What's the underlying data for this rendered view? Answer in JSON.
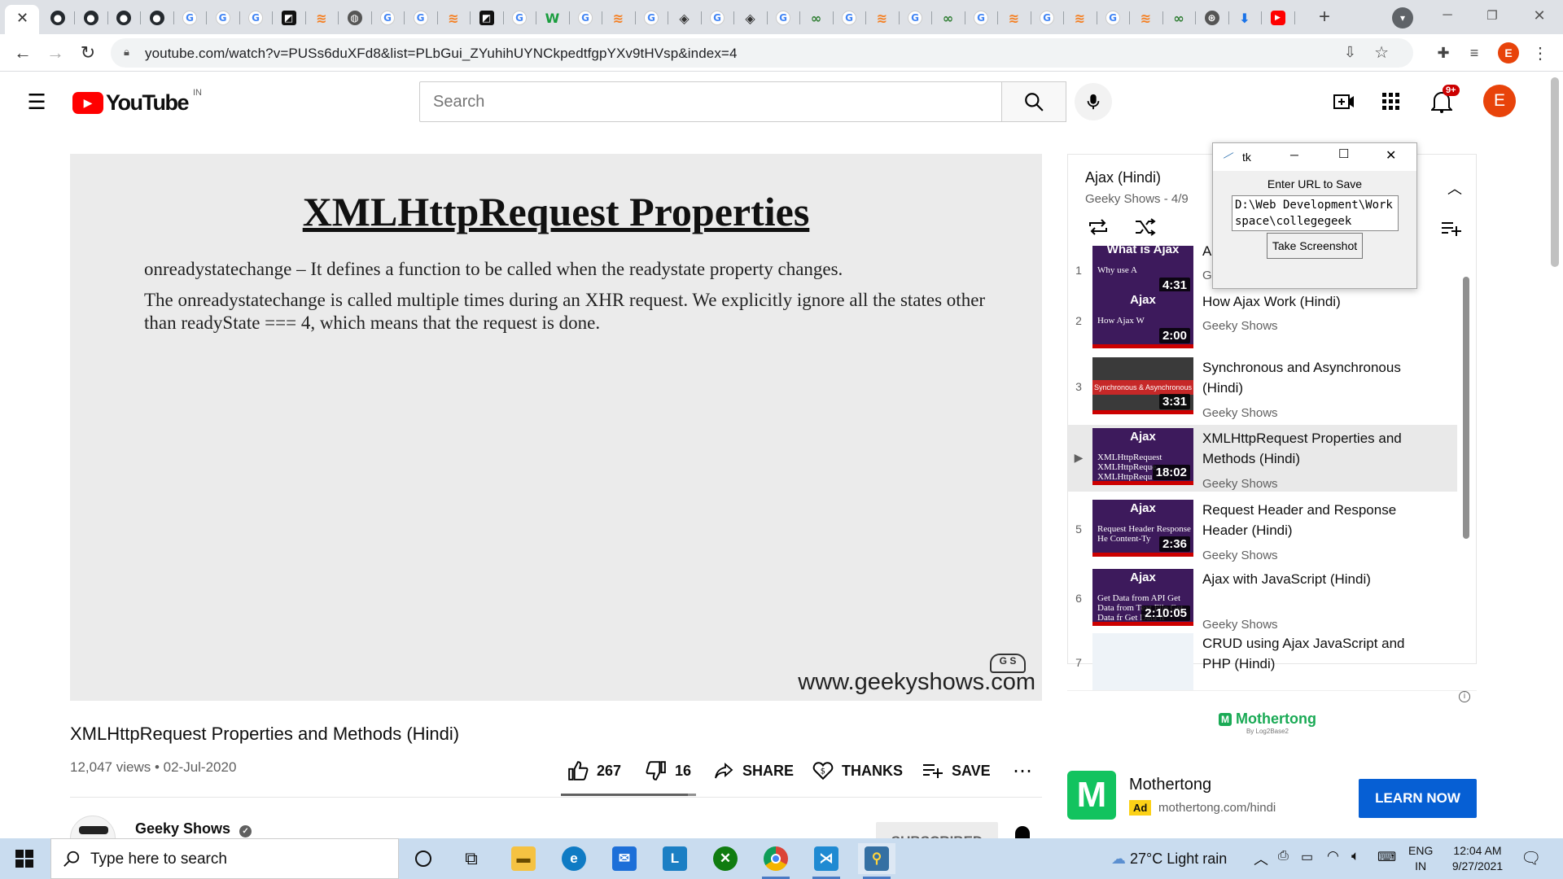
{
  "browser": {
    "url": "youtube.com/watch?v=PUSs6duXFd8&list=PLbGui_ZYuhihUYNCkpedtfgpYXv9tHVsp&index=4",
    "profile_initial": "E",
    "tabs": [
      "close-icon",
      "github",
      "github",
      "github",
      "github",
      "google",
      "google",
      "google",
      "square-app",
      "stack-overflow",
      "globe",
      "google",
      "google",
      "stack-overflow",
      "square-app",
      "google",
      "w-app",
      "google",
      "stack-overflow",
      "google",
      "diamond",
      "google",
      "diamond",
      "google",
      "infinity",
      "google",
      "stack-overflow",
      "google",
      "infinity",
      "google",
      "stack-overflow",
      "google",
      "stack-overflow",
      "google",
      "stack-overflow",
      "infinity",
      "wheel",
      "download",
      "youtube"
    ]
  },
  "youtube": {
    "logo_text": "YouTube",
    "region": "IN",
    "search_placeholder": "Search",
    "notification_count": "9+",
    "avatar_initial": "E"
  },
  "video": {
    "slide_title": "XMLHttpRequest Properties",
    "slide_p1": "onreadystatechange – It defines a function to be called when the readystate property changes.",
    "slide_p2": "The onreadystatechange is called multiple times during an XHR request. We explicitly ignore all the states other than readyState === 4, which means that the request is done.",
    "watermark": "www.geekyshows.com",
    "title": "XMLHttpRequest Properties and Methods (Hindi)",
    "views": "12,047 views • 02-Jul-2020",
    "likes": "267",
    "dislikes": "16",
    "like_ratio": 0.94,
    "share_label": "SHARE",
    "thanks_label": "THANKS",
    "save_label": "SAVE",
    "channel": "Geeky Shows",
    "subscribe_label": "SUBSCRIBED"
  },
  "playlist": {
    "title": "Ajax (Hindi)",
    "subtitle": "Geeky Shows - 4/9",
    "items": [
      {
        "index": "1",
        "thumb_text": "What is Ajax",
        "thumb_sub": "Why use A",
        "duration": "4:31",
        "title": "A",
        "channel": "Gi"
      },
      {
        "index": "2",
        "thumb_text": "Ajax",
        "thumb_sub": "How Ajax W",
        "duration": "2:00",
        "title": "How Ajax Work (Hindi)",
        "channel": "Geeky Shows"
      },
      {
        "index": "3",
        "thumb_text": "",
        "thumb_sub": "Synchronous & Asynchronous",
        "duration": "3:31",
        "title": "Synchronous and Asynchronous (Hindi)",
        "channel": "Geeky Shows"
      },
      {
        "index": "▶",
        "thumb_text": "Ajax",
        "thumb_sub": "XMLHttpRequest XMLHttpReque XMLHttpRequ",
        "duration": "18:02",
        "title": "XMLHttpRequest Properties and Methods (Hindi)",
        "channel": "Geeky Shows"
      },
      {
        "index": "5",
        "thumb_text": "Ajax",
        "thumb_sub": "Request Header Response He Content-Ty",
        "duration": "2:36",
        "title": "Request Header and Response Header (Hindi)",
        "channel": "Geeky Shows"
      },
      {
        "index": "6",
        "thumb_text": "Ajax",
        "thumb_sub": "Get Data from API Get Data from Text File Get Data fr Get Data fr",
        "duration": "2:10:05",
        "title": "Ajax with JavaScript (Hindi)",
        "channel": "Geeky Shows"
      },
      {
        "index": "7",
        "thumb_text": "",
        "thumb_sub": "",
        "duration": "",
        "title": "CRUD using Ajax JavaScript and PHP (Hindi)",
        "channel": ""
      }
    ]
  },
  "tk": {
    "title": "tk",
    "label": "Enter URL to Save",
    "text": "D:\\Web Development\\Workspace\\collegegeek",
    "button": "Take Screenshot"
  },
  "ad": {
    "banner_brand": "Mothertong",
    "banner_sub": "By Log2Base2",
    "name": "Mothertong",
    "badge": "Ad",
    "url": "mothertong.com/hindi",
    "cta": "LEARN NOW"
  },
  "taskbar": {
    "search_placeholder": "Type here to search",
    "weather": "27°C  Light rain",
    "lang1": "ENG",
    "lang2": "IN",
    "time": "12:04 AM",
    "date": "9/27/2021"
  }
}
